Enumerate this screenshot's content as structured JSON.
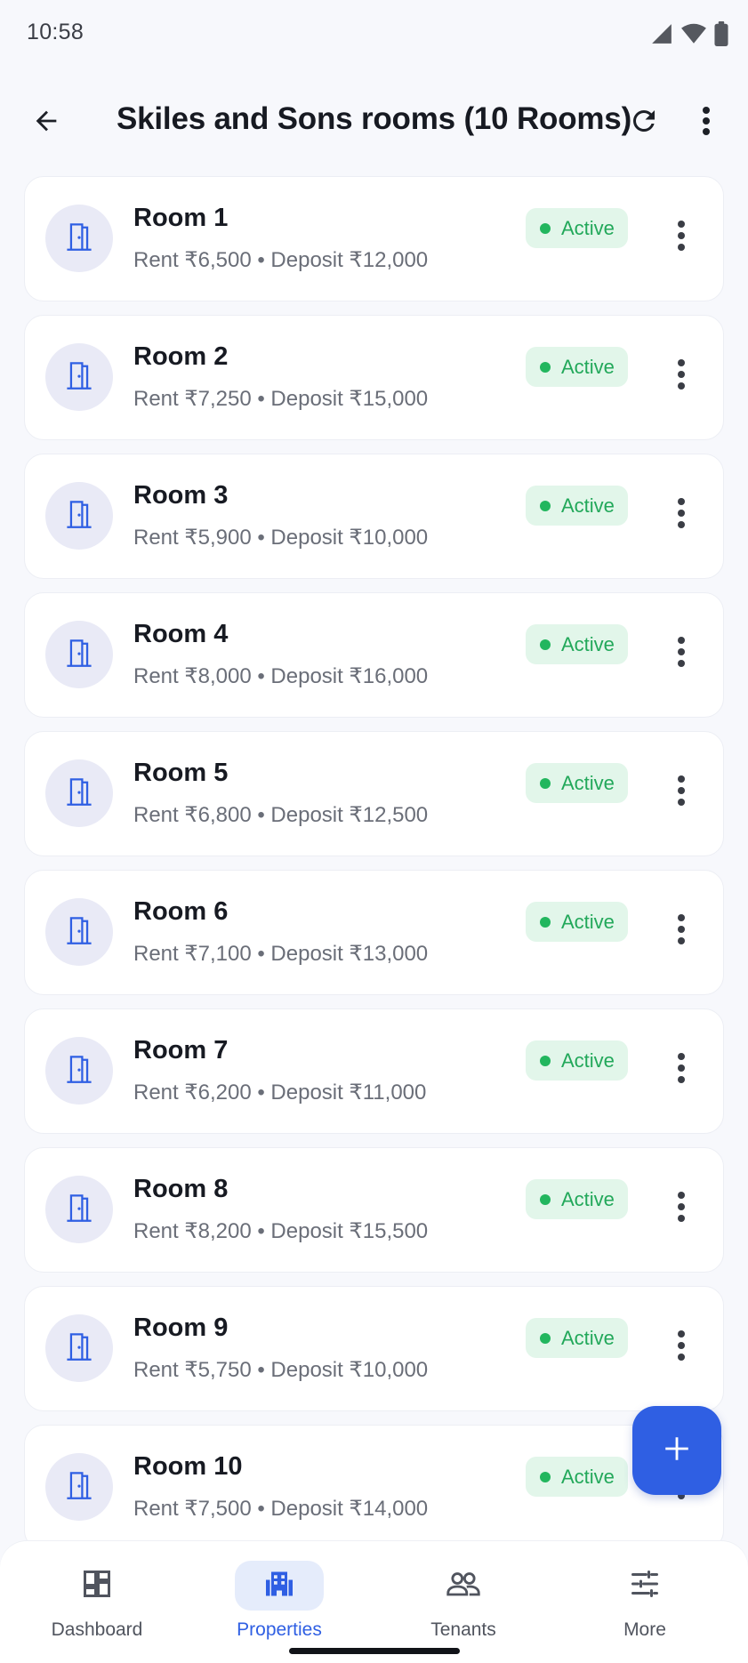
{
  "status_bar": {
    "time": "10:58"
  },
  "app_bar": {
    "title": "Skiles and Sons rooms (10 Rooms)",
    "back_icon": "arrow-left-icon",
    "refresh_icon": "refresh-icon",
    "menu_icon": "more-vert-icon"
  },
  "rooms": [
    {
      "name": "Room 1",
      "subtitle": "Rent ₹6,500 • Deposit ₹12,000",
      "status": "Active"
    },
    {
      "name": "Room 2",
      "subtitle": "Rent ₹7,250 • Deposit ₹15,000",
      "status": "Active"
    },
    {
      "name": "Room 3",
      "subtitle": "Rent ₹5,900 • Deposit ₹10,000",
      "status": "Active"
    },
    {
      "name": "Room 4",
      "subtitle": "Rent ₹8,000 • Deposit ₹16,000",
      "status": "Active"
    },
    {
      "name": "Room 5",
      "subtitle": "Rent ₹6,800 • Deposit ₹12,500",
      "status": "Active"
    },
    {
      "name": "Room 6",
      "subtitle": "Rent ₹7,100 • Deposit ₹13,000",
      "status": "Active"
    },
    {
      "name": "Room 7",
      "subtitle": "Rent ₹6,200 • Deposit ₹11,000",
      "status": "Active"
    },
    {
      "name": "Room 8",
      "subtitle": "Rent ₹8,200 • Deposit ₹15,500",
      "status": "Active"
    },
    {
      "name": "Room 9",
      "subtitle": "Rent ₹5,750 • Deposit ₹10,000",
      "status": "Active"
    },
    {
      "name": "Room 10",
      "subtitle": "Rent ₹7,500 • Deposit ₹14,000",
      "status": "Active"
    }
  ],
  "fab": {
    "icon": "plus-icon"
  },
  "bottom_nav": {
    "items": [
      {
        "label": "Dashboard",
        "icon": "dashboard-icon",
        "active": false
      },
      {
        "label": "Properties",
        "icon": "building-icon",
        "active": true
      },
      {
        "label": "Tenants",
        "icon": "people-icon",
        "active": false
      },
      {
        "label": "More",
        "icon": "sliders-icon",
        "active": false
      }
    ]
  },
  "colors": {
    "accent": "#2f5fe3",
    "active_green": "#22b65e",
    "badge_bg": "#e2f6ea",
    "avatar_bg": "#e9eaf6"
  }
}
